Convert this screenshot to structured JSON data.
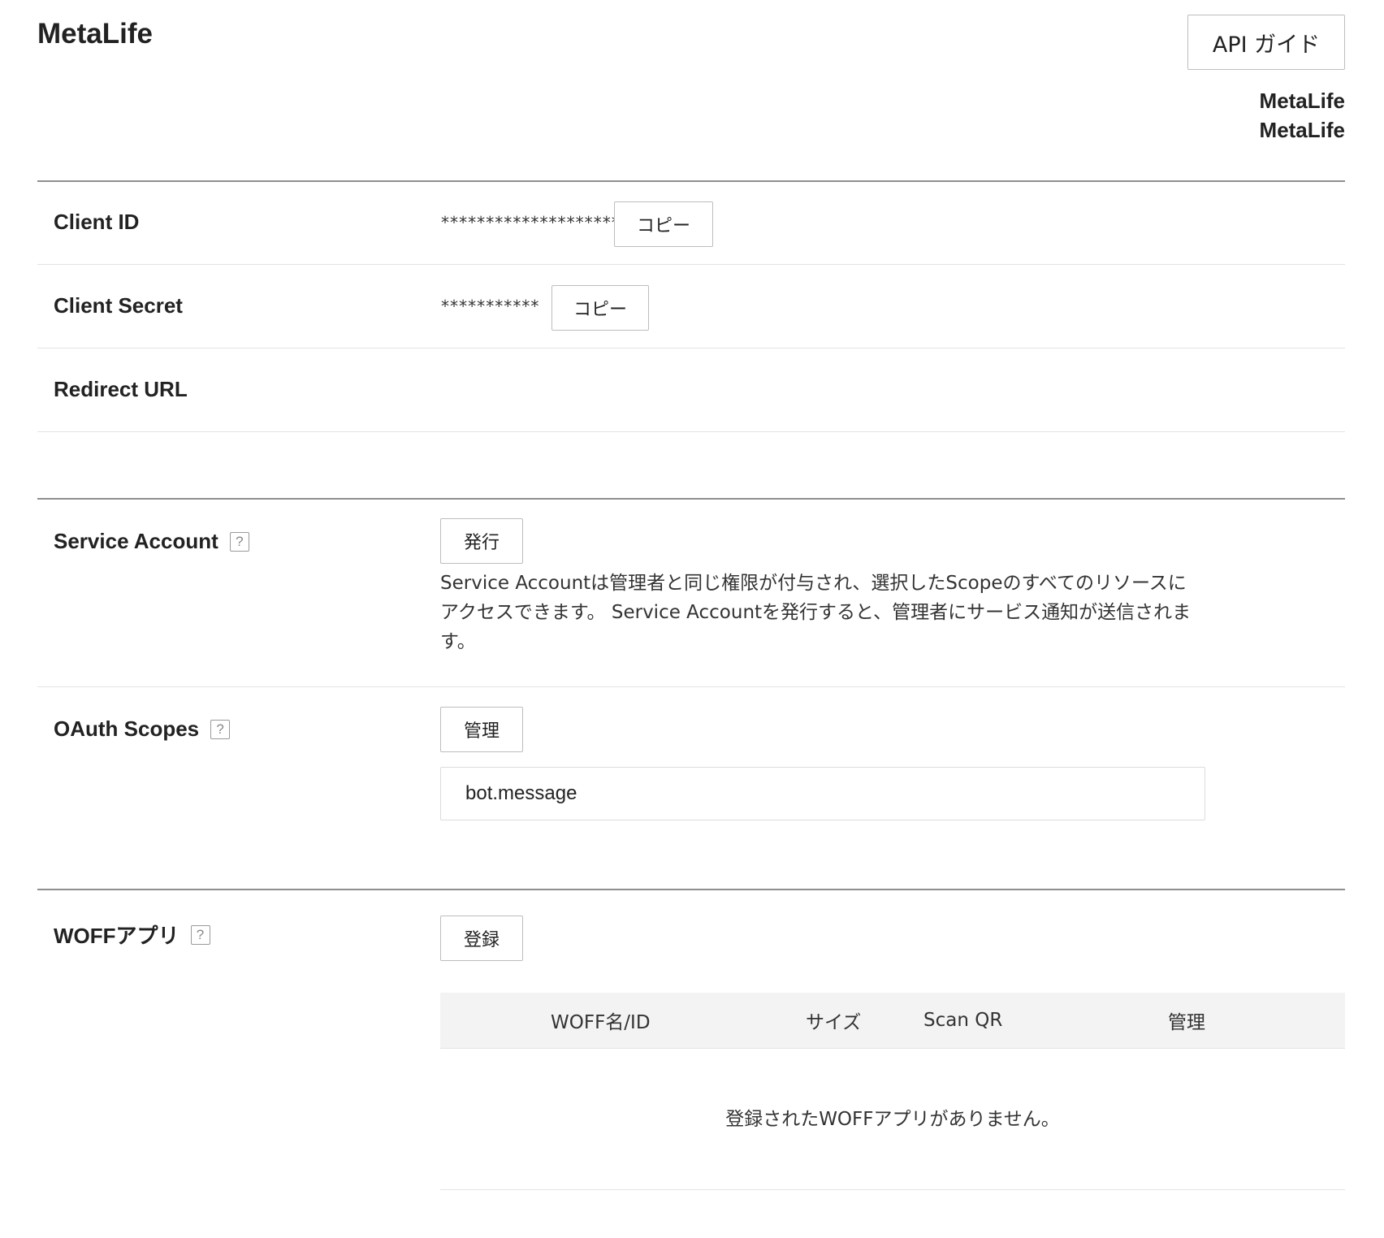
{
  "header": {
    "title": "MetaLife",
    "api_guide_label": "API ガイド",
    "owner_line1": "MetaLife",
    "owner_line2": "MetaLife"
  },
  "credentials": {
    "client_id": {
      "label": "Client ID",
      "masked_value": "********************",
      "copy_label": "コピー"
    },
    "client_secret": {
      "label": "Client Secret",
      "masked_value": "***********",
      "copy_label": "コピー"
    },
    "redirect_url": {
      "label": "Redirect URL",
      "value": ""
    }
  },
  "service_account": {
    "label": "Service Account",
    "help_icon": "?",
    "issue_label": "発行",
    "description": "Service Accountは管理者と同じ権限が付与され、選択したScopeのすべてのリソースにアクセスできます。 Service Accountを発行すると、管理者にサービス通知が送信されます。"
  },
  "oauth_scopes": {
    "label": "OAuth Scopes",
    "help_icon": "?",
    "manage_label": "管理",
    "scopes_value": "bot.message"
  },
  "woff": {
    "label": "WOFFアプリ",
    "help_icon": "?",
    "register_label": "登録",
    "columns": [
      "WOFF名/ID",
      "サイズ",
      "Scan QR",
      "管理"
    ],
    "empty_message": "登録されたWOFFアプリがありません。"
  }
}
